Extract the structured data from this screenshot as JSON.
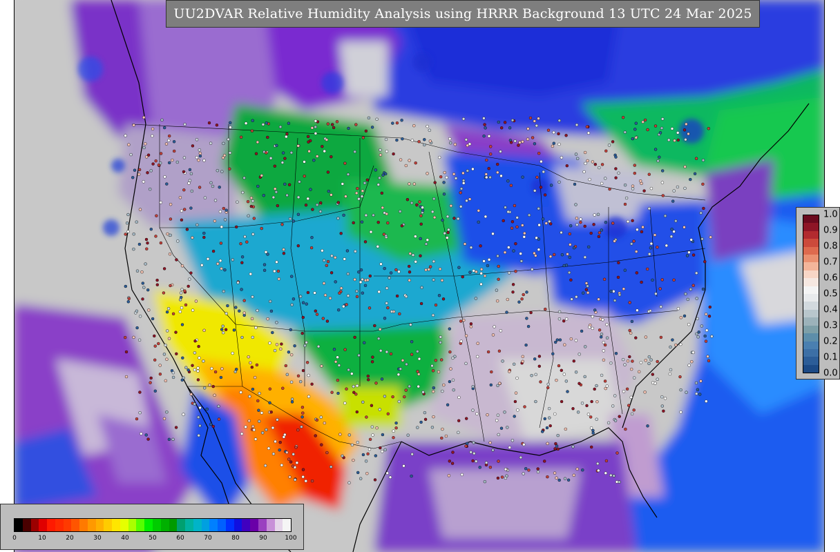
{
  "title": "UU2DVAR Relative Humidity Analysis using HRRR Background 13 UTC 24 Mar 2025",
  "rh_legend": {
    "ticks": [
      "0",
      "10",
      "20",
      "30",
      "40",
      "50",
      "60",
      "70",
      "80",
      "90",
      "100"
    ],
    "colors": [
      "#000000",
      "#4a0000",
      "#9c0000",
      "#e00000",
      "#ff1a00",
      "#ff2a00",
      "#ff3a00",
      "#ff5500",
      "#ff7a00",
      "#ff9900",
      "#ffb000",
      "#ffcc00",
      "#ffe600",
      "#e6ff00",
      "#aaff00",
      "#55ff00",
      "#00ee00",
      "#00cc00",
      "#00b000",
      "#009a00",
      "#00a070",
      "#00b2a0",
      "#00b4c8",
      "#00a0e0",
      "#0080ff",
      "#0060ff",
      "#0030ff",
      "#1010e0",
      "#4000c0",
      "#6a00a8",
      "#9a40c0",
      "#c890d8",
      "#e6d6ea",
      "#f5f5f5"
    ]
  },
  "increment_legend": {
    "ticks": [
      "1.0",
      "0.9",
      "0.8",
      "0.7",
      "0.6",
      "0.5",
      "0.4",
      "0.3",
      "0.2",
      "0.1",
      "0.0"
    ],
    "colors": [
      "#6b0a1e",
      "#8e1526",
      "#b22a2f",
      "#cc4a3b",
      "#de6a4e",
      "#ea9070",
      "#f3b59a",
      "#f8d6c6",
      "#f6e8e1",
      "#f4f4f4",
      "#e8eaec",
      "#d2d9de",
      "#b8c6cc",
      "#9cb2ba",
      "#7d9fa8",
      "#5d8eaa",
      "#4a7fb0",
      "#3c6fa6",
      "#2c5d98",
      "#1c4a86"
    ]
  },
  "stations": {
    "station_colors": [
      "#ffffff",
      "#cfd9e0",
      "#a8bcc8",
      "#f4c2b2",
      "#c2413b",
      "#8e1526",
      "#2c5d98"
    ]
  }
}
